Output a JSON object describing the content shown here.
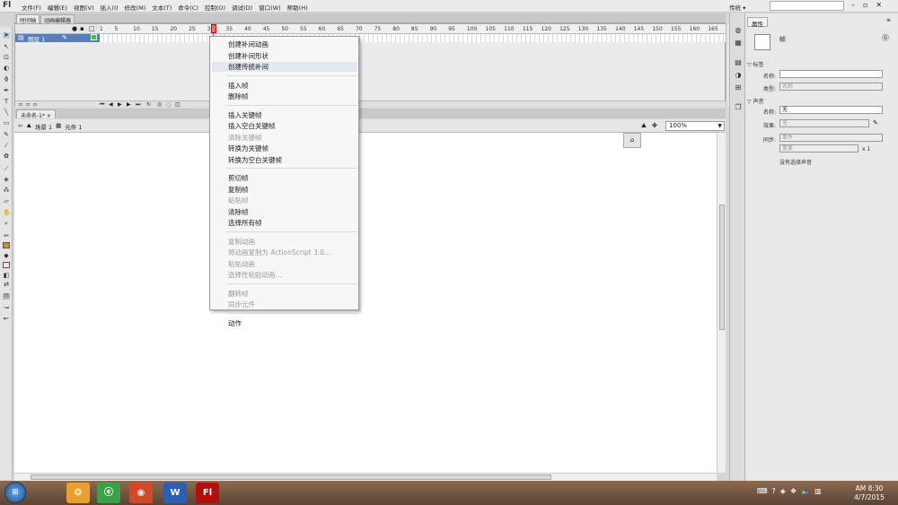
{
  "app": {
    "logo": "Fl"
  },
  "menubar": {
    "items": [
      "文件(F)",
      "编辑(E)",
      "视图(V)",
      "插入(I)",
      "修改(M)",
      "文本(T)",
      "命令(C)",
      "控制(O)",
      "调试(D)",
      "窗口(W)",
      "帮助(H)"
    ],
    "workspace": "传统",
    "workspace_arrow": "▾",
    "controls": {
      "minimize": "–",
      "restore": "▫",
      "close": "✕"
    }
  },
  "timeline": {
    "tabs": [
      "时间轴",
      "动画编辑器"
    ],
    "layer_name": "图层 1",
    "ruler": [
      "1",
      "5",
      "10",
      "15",
      "20",
      "25",
      "30",
      "35",
      "40",
      "45",
      "50",
      "55",
      "60",
      "65",
      "70",
      "75",
      "80",
      "85",
      "90",
      "95",
      "100",
      "105",
      "110",
      "115",
      "120",
      "125",
      "130",
      "135",
      "140",
      "145",
      "150",
      "155",
      "160",
      "165"
    ]
  },
  "document": {
    "tab": "未命名-1*",
    "tab_close": "×",
    "scene": "场景 1",
    "symbol": "元件 1",
    "zoom": "100%"
  },
  "context_menu": {
    "groups": [
      [
        {
          "label": "创建补间动画",
          "enabled": true
        },
        {
          "label": "创建补间形状",
          "enabled": true
        },
        {
          "label": "创建传统补间",
          "enabled": true,
          "highlighted": true
        }
      ],
      [
        {
          "label": "插入帧",
          "enabled": true
        },
        {
          "label": "删除帧",
          "enabled": true
        }
      ],
      [
        {
          "label": "插入关键帧",
          "enabled": true
        },
        {
          "label": "插入空白关键帧",
          "enabled": true
        },
        {
          "label": "清除关键帧",
          "enabled": false
        },
        {
          "label": "转换为关键帧",
          "enabled": true
        },
        {
          "label": "转换为空白关键帧",
          "enabled": true
        }
      ],
      [
        {
          "label": "剪切帧",
          "enabled": true
        },
        {
          "label": "复制帧",
          "enabled": true
        },
        {
          "label": "粘贴帧",
          "enabled": false
        },
        {
          "label": "清除帧",
          "enabled": true
        },
        {
          "label": "选择所有帧",
          "enabled": true
        }
      ],
      [
        {
          "label": "复制动画",
          "enabled": false
        },
        {
          "label": "将动画复制为 ActionScript 3.0...",
          "enabled": false
        },
        {
          "label": "粘贴动画",
          "enabled": false
        },
        {
          "label": "选择性粘贴动画...",
          "enabled": false
        }
      ],
      [
        {
          "label": "翻转帧",
          "enabled": false
        },
        {
          "label": "同步元件",
          "enabled": false
        }
      ],
      [
        {
          "label": "动作",
          "enabled": true
        }
      ]
    ]
  },
  "properties": {
    "tab": "属性",
    "object_type": "帧",
    "label_section": "标签",
    "name_label": "名称:",
    "name_value": "",
    "type_label": "类型:",
    "type_value": "名称",
    "sound_section": "声音",
    "sound_name_label": "名称:",
    "sound_name_value": "无",
    "effect_label": "效果:",
    "effect_value": "无",
    "sync_label": "同步:",
    "sync_value": "事件",
    "repeat_value": "重复",
    "repeat_count": "x 1",
    "no_sound": "没有选择声音"
  },
  "taskbar": {
    "start": "⊞",
    "apps": [
      {
        "name": "qq-app",
        "glyph": "❂",
        "color": "#e8a030"
      },
      {
        "name": "browser-app",
        "glyph": "ⓔ",
        "color": "#3aa04a"
      },
      {
        "name": "chrome-app",
        "glyph": "◉",
        "color": "#d04a2a"
      },
      {
        "name": "word-app",
        "glyph": "W",
        "color": "#2b5fb4"
      },
      {
        "name": "flash-app",
        "glyph": "Fl",
        "color": "#b01010"
      }
    ],
    "clock_time": "AM 8:30",
    "clock_date": "4/7/2015"
  }
}
